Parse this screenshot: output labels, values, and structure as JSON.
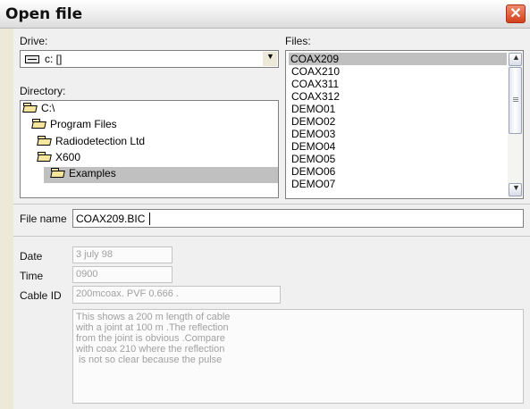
{
  "dialog": {
    "title": "Open file",
    "close_icon": "close-icon"
  },
  "drive": {
    "label": "Drive:",
    "value": "c: []",
    "icon": "drive-icon"
  },
  "directory": {
    "label": "Directory:",
    "items": [
      {
        "label": "C:\\",
        "selected": false
      },
      {
        "label": "Program Files",
        "selected": false
      },
      {
        "label": "Radiodetection Ltd",
        "selected": false
      },
      {
        "label": "X600",
        "selected": false
      },
      {
        "label": "Examples",
        "selected": true
      }
    ]
  },
  "files": {
    "label": "Files:",
    "items": [
      "COAX209",
      "COAX210",
      "COAX311",
      "COAX312",
      "DEMO01",
      "DEMO02",
      "DEMO03",
      "DEMO04",
      "DEMO05",
      "DEMO06",
      "DEMO07"
    ],
    "selected": "COAX209"
  },
  "filename": {
    "label": "File name",
    "value": "COAX209.BIC"
  },
  "details": {
    "date_label": "Date",
    "date": "3 july 98",
    "time_label": "Time",
    "time": "0900",
    "cable_label": "Cable ID",
    "cable": "200mcoax. PVF 0.666 .",
    "notes": "This shows a 200 m length of cable\nwith a joint at 100 m .The reflection\nfrom the joint is obvious .Compare\nwith coax 210 where the reflection\n is not so clear because the pulse"
  },
  "colors": {
    "close_button": "#d3411c",
    "selection": "#c0c0c0",
    "disabled_text": "#a0a0a0"
  }
}
